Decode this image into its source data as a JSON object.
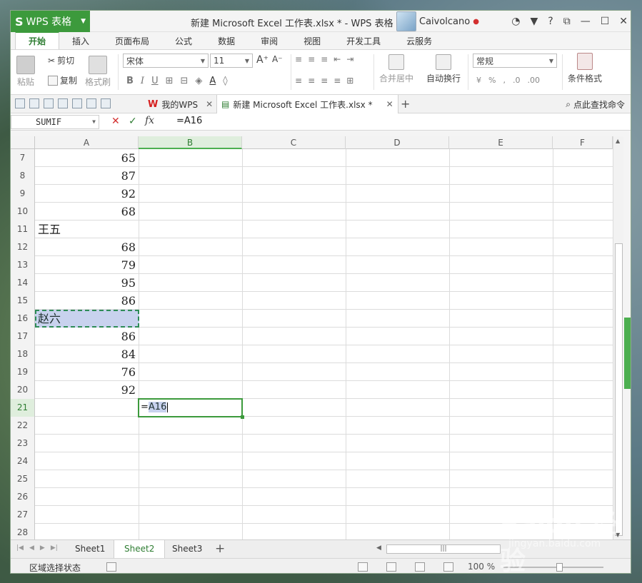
{
  "app": {
    "name": "WPS 表格",
    "window_title": "新建 Microsoft Excel 工作表.xlsx * - WPS 表格",
    "user": "Caivolcano"
  },
  "ribbon_tabs": [
    "开始",
    "插入",
    "页面布局",
    "公式",
    "数据",
    "审阅",
    "视图",
    "开发工具",
    "云服务"
  ],
  "ribbon": {
    "paste": "粘贴",
    "cut": "剪切",
    "copy": "复制",
    "format_painter": "格式刷",
    "font_name": "宋体",
    "font_size": "11",
    "merge_center": "合并居中",
    "wrap_text": "自动换行",
    "number_format": "常规",
    "cond_format": "条件格式"
  },
  "doc_tabs": [
    {
      "label": "我的WPS"
    },
    {
      "label": "新建 Microsoft Excel 工作表.xlsx *"
    }
  ],
  "find_command": "点此查找命令",
  "formula_bar": {
    "name_box": "SUMIF",
    "formula": "=A16",
    "fx": "fx"
  },
  "columns": [
    "A",
    "B",
    "C",
    "D",
    "E",
    "F"
  ],
  "rows": [
    {
      "n": "7",
      "a": "65"
    },
    {
      "n": "8",
      "a": "87"
    },
    {
      "n": "9",
      "a": "92"
    },
    {
      "n": "10",
      "a": "68"
    },
    {
      "n": "11",
      "a": "王五"
    },
    {
      "n": "12",
      "a": "68"
    },
    {
      "n": "13",
      "a": "79"
    },
    {
      "n": "14",
      "a": "95"
    },
    {
      "n": "15",
      "a": "86"
    },
    {
      "n": "16",
      "a": "赵六"
    },
    {
      "n": "17",
      "a": "86"
    },
    {
      "n": "18",
      "a": "84"
    },
    {
      "n": "19",
      "a": "76"
    },
    {
      "n": "20",
      "a": "92"
    },
    {
      "n": "21",
      "a": ""
    },
    {
      "n": "22",
      "a": ""
    },
    {
      "n": "23",
      "a": ""
    },
    {
      "n": "24",
      "a": ""
    },
    {
      "n": "25",
      "a": ""
    },
    {
      "n": "26",
      "a": ""
    },
    {
      "n": "27",
      "a": ""
    },
    {
      "n": "28",
      "a": ""
    }
  ],
  "edit_cell": {
    "prefix": "=",
    "ref": "A16"
  },
  "sheets": [
    "Sheet1",
    "Sheet2",
    "Sheet3"
  ],
  "active_sheet": "Sheet2",
  "status": {
    "mode": "区域选择状态",
    "zoom": "100 %"
  },
  "watermark": {
    "brand": "Baidu 经验",
    "url": "jingyan.baidu.com"
  },
  "colors": {
    "accent": "#3c9a3c",
    "ref_highlight": "#c8d2ee"
  }
}
